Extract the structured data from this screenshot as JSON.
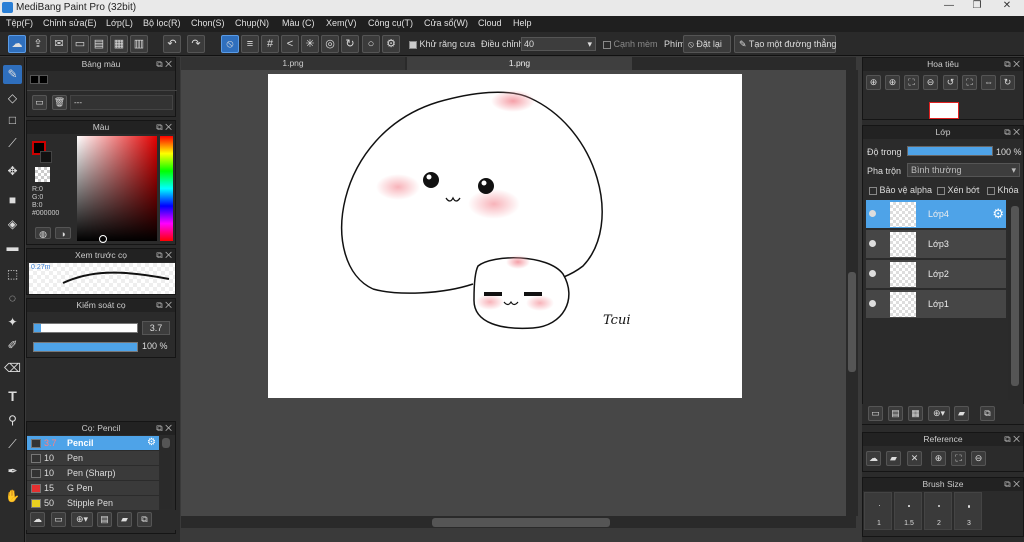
{
  "window": {
    "title": "MediBang Paint Pro (32bit)",
    "min": "—",
    "max": "❐",
    "close": "✕"
  },
  "menu": [
    "Tệp(F)",
    "Chỉnh sửa(E)",
    "Lớp(L)",
    "Bộ lọc(R)",
    "Chọn(S)",
    "Chụp(N)",
    "Màu (C)",
    "Xem(V)",
    "Công cụ(T)",
    "Cửa sổ(W)",
    "Cloud",
    "Help"
  ],
  "toolbar": {
    "antialias_label": "Khử răng cưa",
    "adjust_label": "Điều chỉnh",
    "adjust_value": "40",
    "edge_label": "Cạnh mèm",
    "key_label": "Phím",
    "reset_label": "Đặt lại",
    "straight_label": "Tạo một đường thẳng"
  },
  "tabs": [
    "1.png",
    "1.png"
  ],
  "palette": {
    "title": "Bảng màu",
    "value": "---"
  },
  "color": {
    "title": "Màu",
    "r": "R:0",
    "g": "G:0",
    "b": "B:0",
    "hex": "#000000",
    "fg": "#b30000"
  },
  "brush_preview": {
    "title": "Xem trước cọ",
    "size": "0.27m"
  },
  "brush_control": {
    "title": "Kiểm soát cọ",
    "size_value": "3.7",
    "opacity_value": "100 %",
    "size_fill": 0.07,
    "opacity_fill": 1.0
  },
  "brushes": {
    "title": "Cọ: Pencil",
    "items": [
      {
        "size": "3.7",
        "name": "Pencil",
        "swatch": "#333333",
        "selected": true
      },
      {
        "size": "10",
        "name": "Pen",
        "swatch": "#333333",
        "selected": false
      },
      {
        "size": "10",
        "name": "Pen (Sharp)",
        "swatch": "#333333",
        "selected": false
      },
      {
        "size": "15",
        "name": "G Pen",
        "swatch": "#e53030",
        "selected": false
      },
      {
        "size": "50",
        "name": "Stipple Pen",
        "swatch": "#e8d020",
        "selected": false
      }
    ]
  },
  "navigator": {
    "title": "Hoa tiêu"
  },
  "layer_panel": {
    "title": "Lớp",
    "opacity_label": "Độ trong",
    "opacity_value": "100 %",
    "blend_label": "Pha trộn",
    "blend_value": "Bình thường",
    "protect_alpha": "Bảo vệ alpha",
    "clipping": "Xén bớt",
    "lock": "Khóa",
    "layers": [
      {
        "name": "Lớp4",
        "selected": true
      },
      {
        "name": "Lớp3",
        "selected": false
      },
      {
        "name": "Lớp2",
        "selected": false
      },
      {
        "name": "Lớp1",
        "selected": false
      }
    ]
  },
  "reference": {
    "title": "Reference"
  },
  "brush_size": {
    "title": "Brush Size",
    "sizes": [
      "1",
      "1.5",
      "2",
      "3"
    ]
  },
  "canvas_art": {
    "signature": "Tcui"
  }
}
